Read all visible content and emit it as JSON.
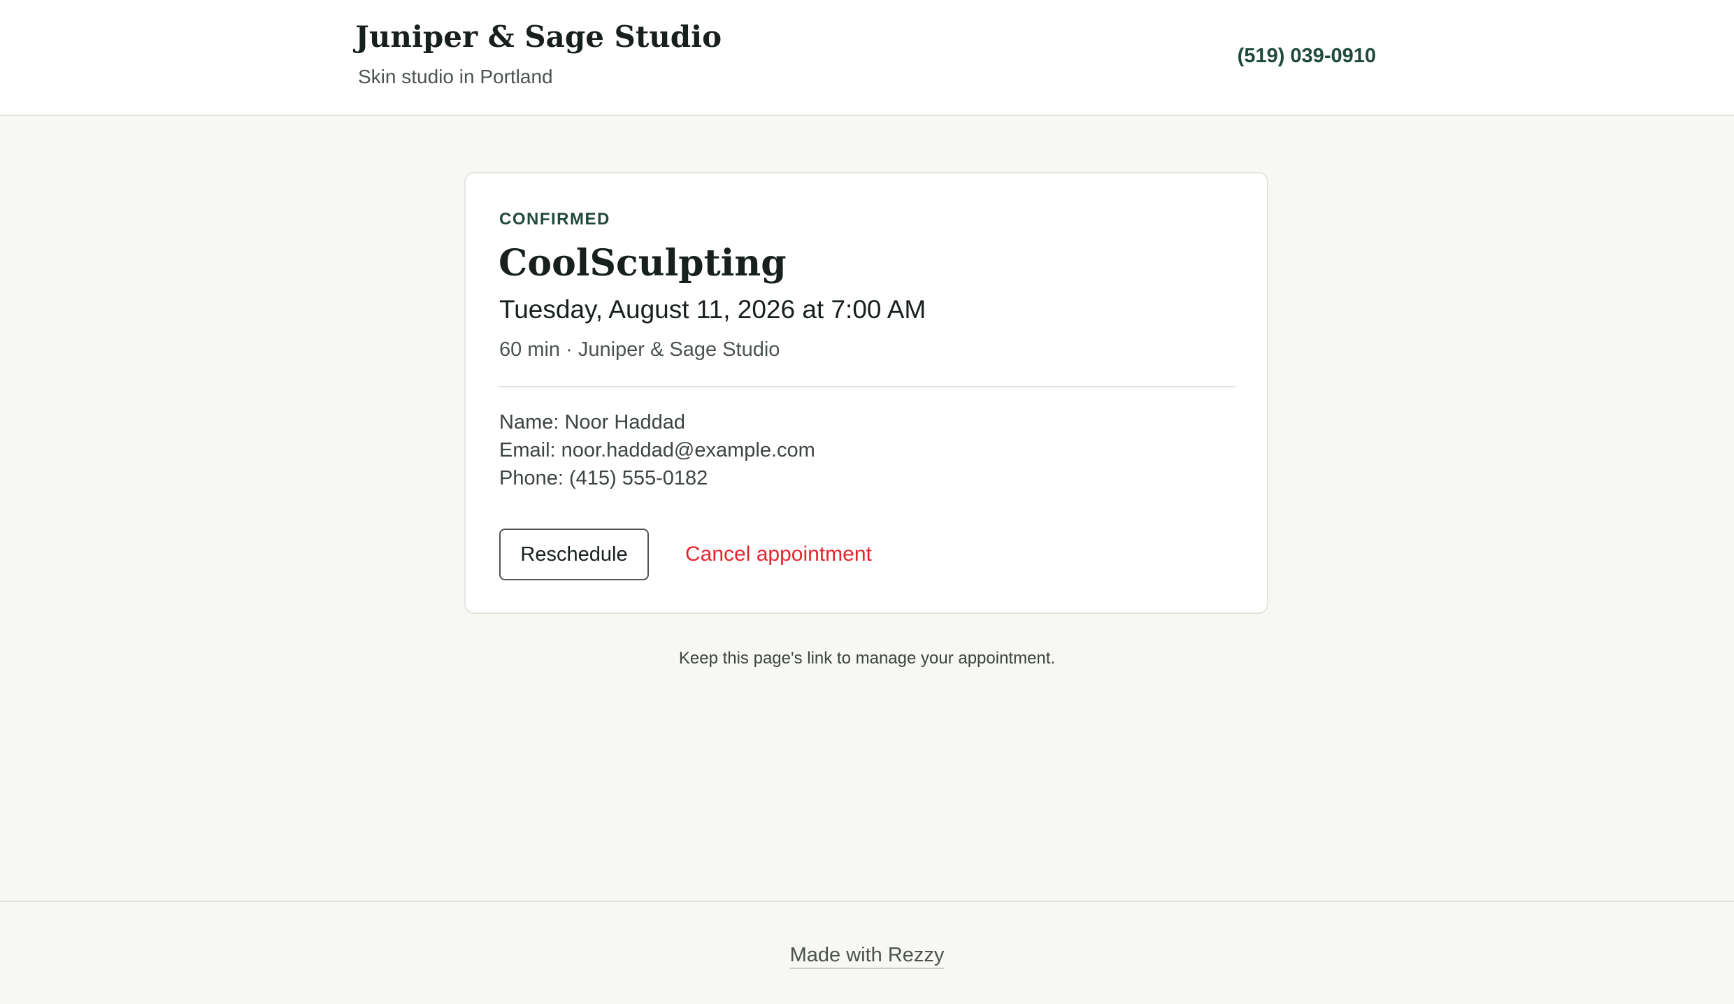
{
  "header": {
    "business_name": "Juniper & Sage Studio",
    "tagline": "Skin studio in Portland",
    "phone": "(519) 039-0910"
  },
  "booking": {
    "status": "CONFIRMED",
    "service": "CoolSculpting",
    "datetime": "Tuesday, August 11, 2026 at 7:00 AM",
    "meta": "60 min · Juniper & Sage Studio",
    "details": {
      "name": "Name: Noor Haddad",
      "email": "Email: noor.haddad@example.com",
      "phone": "Phone: (415) 555-0182"
    },
    "actions": {
      "reschedule_label": "Reschedule",
      "cancel_label": "Cancel appointment"
    }
  },
  "note": "Keep this page's link to manage your appointment.",
  "footer": {
    "link_label": "Made with Rezzy"
  },
  "colors": {
    "accent_green": "#1f4a3a",
    "danger_red": "#e8242f",
    "page_bg": "#f7f7f3"
  }
}
